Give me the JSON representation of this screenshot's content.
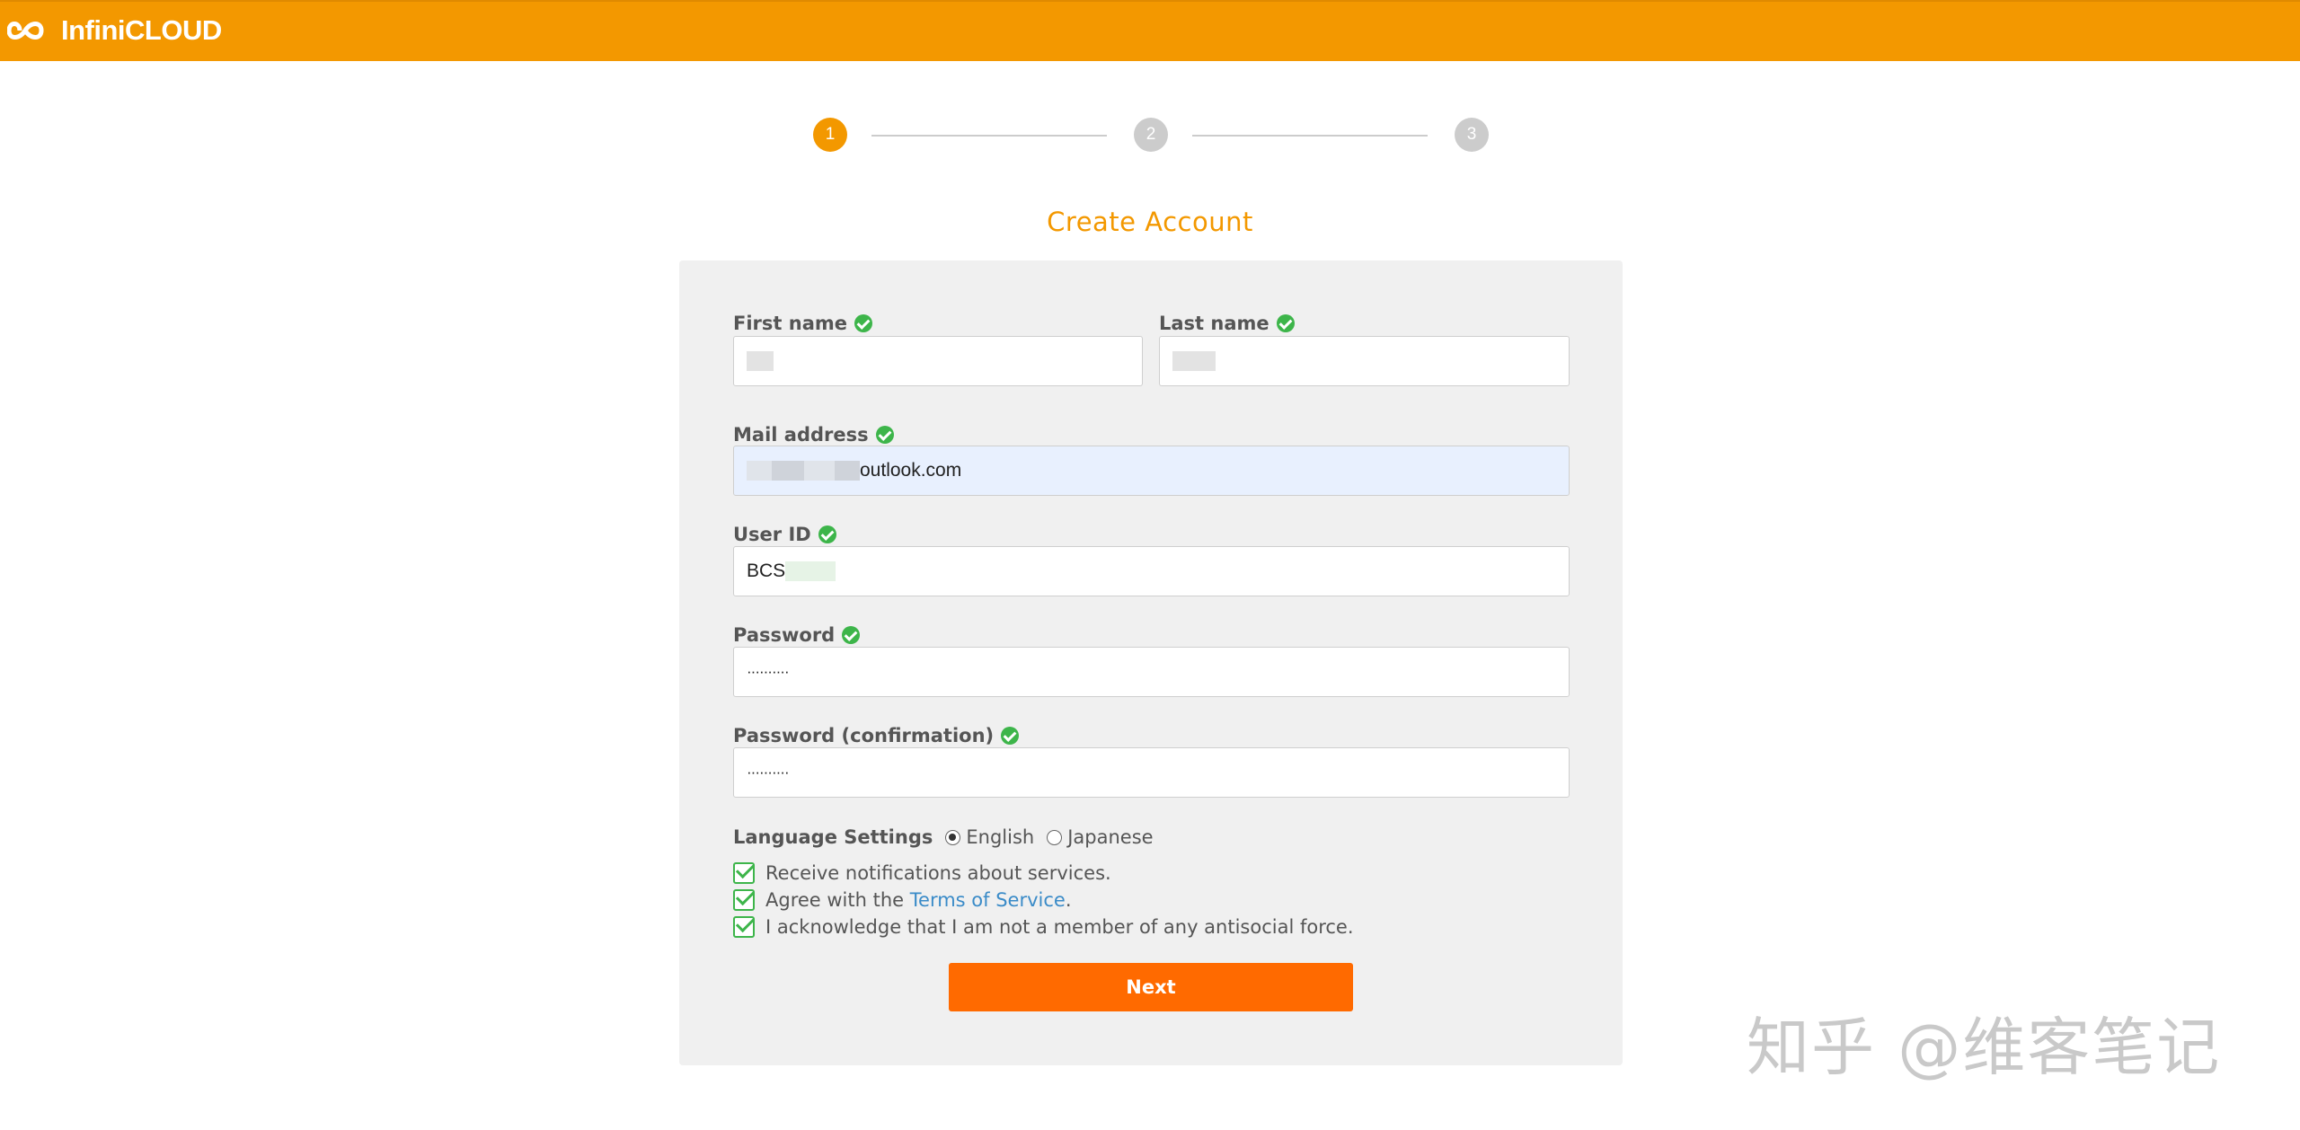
{
  "header": {
    "brand": "InfiniCLOUD"
  },
  "stepper": {
    "steps": [
      "1",
      "2",
      "3"
    ],
    "current_step": 1
  },
  "page": {
    "title": "Create Account"
  },
  "form": {
    "first_name": {
      "label": "First name",
      "value": ""
    },
    "last_name": {
      "label": "Last name",
      "value": ""
    },
    "mail": {
      "label": "Mail address",
      "value_suffix": "outlook.com"
    },
    "user_id": {
      "label": "User ID",
      "value_prefix": "BCS"
    },
    "password": {
      "label": "Password",
      "value": "··········"
    },
    "password_confirm": {
      "label": "Password (confirmation)",
      "value": "··········"
    },
    "language": {
      "label": "Language Settings",
      "options": [
        "English",
        "Japanese"
      ],
      "selected": "English"
    },
    "checkboxes": {
      "notifications": "Receive notifications about services.",
      "terms_prefix": "Agree with the ",
      "terms_link": "Terms of Service",
      "terms_suffix": ".",
      "antisocial": "I acknowledge that I am not a member of any antisocial force."
    },
    "next_label": "Next"
  },
  "watermark": "知乎 @维客笔记",
  "colors": {
    "brand_orange": "#f39800",
    "button_orange": "#ff6a00",
    "valid_green": "#3db54a",
    "link_blue": "#3a8bc8"
  }
}
